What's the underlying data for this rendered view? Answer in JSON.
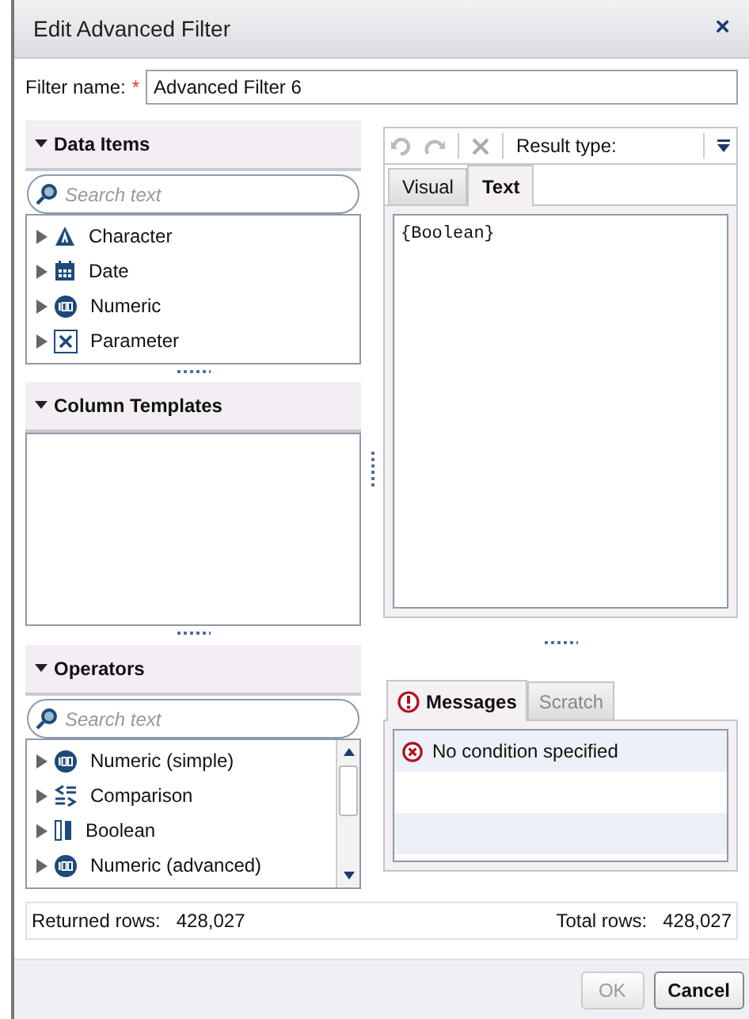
{
  "window": {
    "title": "Edit Advanced Filter",
    "close": "×"
  },
  "filter_name": {
    "label": "Filter name:",
    "required": "*",
    "value": "Advanced Filter 6"
  },
  "data_items": {
    "title": "Data Items",
    "search_placeholder": "Search text",
    "items": [
      {
        "label": "Character",
        "kind": "character"
      },
      {
        "label": "Date",
        "kind": "date"
      },
      {
        "label": "Numeric",
        "kind": "numeric"
      },
      {
        "label": "Parameter",
        "kind": "parameter"
      }
    ]
  },
  "column_templates": {
    "title": "Column Templates"
  },
  "operators": {
    "title": "Operators",
    "search_placeholder": "Search text",
    "items": [
      {
        "label": "Numeric (simple)",
        "kind": "numeric"
      },
      {
        "label": "Comparison",
        "kind": "comparison"
      },
      {
        "label": "Boolean",
        "kind": "boolean"
      },
      {
        "label": "Numeric (advanced)",
        "kind": "numeric"
      }
    ]
  },
  "toolbar": {
    "result_type_label": "Result type:"
  },
  "editor_tabs": [
    {
      "label": "Visual",
      "selected": false
    },
    {
      "label": "Text",
      "selected": true
    }
  ],
  "expression": "{Boolean}",
  "message_tabs": [
    {
      "label": "Messages",
      "selected": true
    },
    {
      "label": "Scratch",
      "selected": false
    }
  ],
  "messages": [
    {
      "text": "No condition specified",
      "kind": "error"
    }
  ],
  "status_bar": {
    "returned_label": "Returned rows:",
    "returned_value": "428,027",
    "total_label": "Total rows:",
    "total_value": "428,027"
  },
  "buttons": [
    {
      "label": "OK",
      "disabled": true
    },
    {
      "label": "Cancel",
      "disabled": false
    }
  ]
}
